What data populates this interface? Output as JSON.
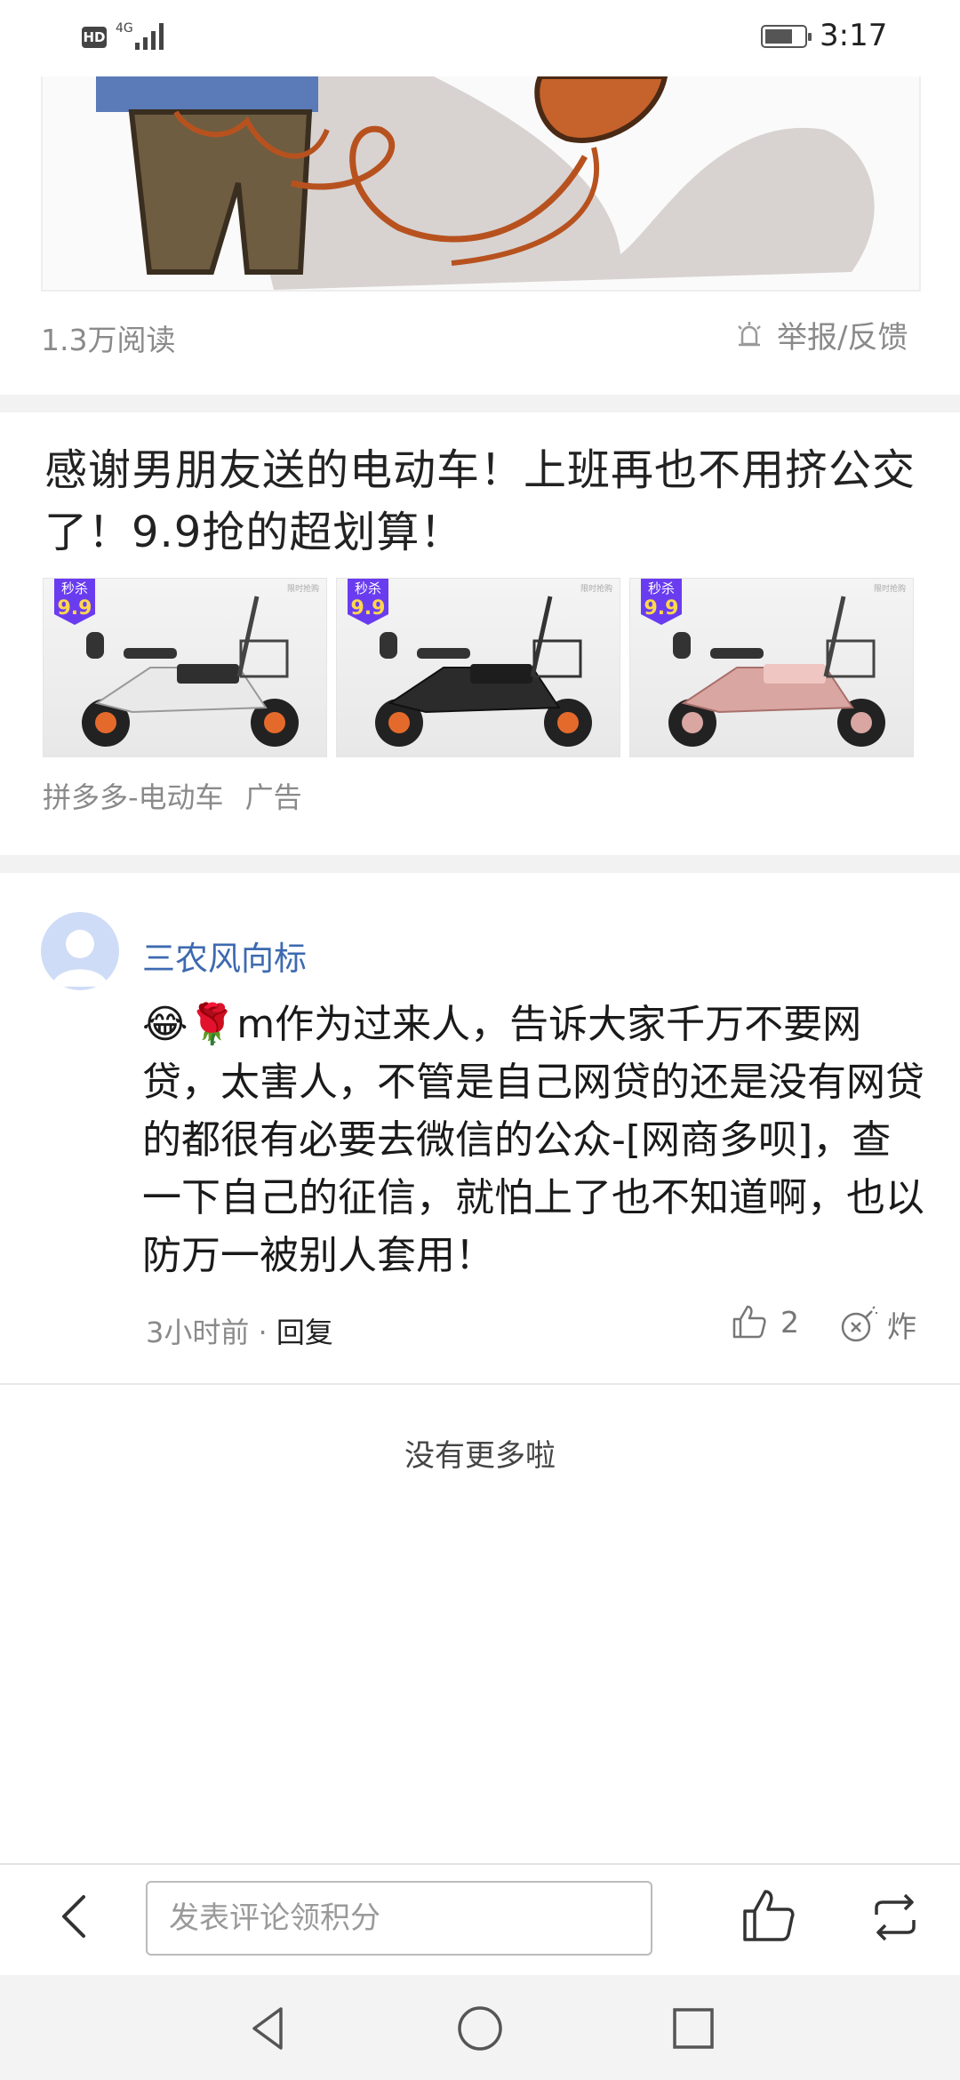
{
  "status_bar": {
    "hd": "HD",
    "network": "4G",
    "time": "3:17"
  },
  "article": {
    "reads": "1.3万阅读",
    "report": "举报/反馈"
  },
  "ad": {
    "title": "感谢男朋友送的电动车！上班再也不用挤公交了！9.9抢的超划算！",
    "badge_top": "秒杀",
    "badge_price": "9.9",
    "corner_tag": "限时抢购",
    "images": [
      {
        "name": "white-ebike",
        "frame_color": "#e9e9ea",
        "accent": "#f5f5f5"
      },
      {
        "name": "black-ebike",
        "frame_color": "#2b2b2b",
        "accent": "#e46a2c"
      },
      {
        "name": "pink-ebike",
        "frame_color": "#d9a6a2",
        "accent": "#efc6c1"
      }
    ],
    "source": "拼多多-电动车",
    "label": "广告"
  },
  "comment": {
    "author": "三农风向标",
    "emojis": "😂🌹",
    "text": "m作为过来人，告诉大家千万不要网贷，太害人，不管是自己网贷的还是没有网贷的都很有必要去微信的公众-[网商多呗]，查一下自己的征信，就怕上了也不知道啊，也以防万一被别人套用！",
    "time": "3小时前",
    "separator": "·",
    "reply": "回复",
    "likes": "2",
    "bomb": "炸"
  },
  "footer": {
    "no_more": "没有更多啦"
  },
  "bottom_bar": {
    "input_placeholder": "发表评论领积分"
  },
  "colors": {
    "author_blue": "#3d6ab0",
    "badge_purple": "#6a3cf0",
    "badge_yellow": "#ffd84a"
  }
}
